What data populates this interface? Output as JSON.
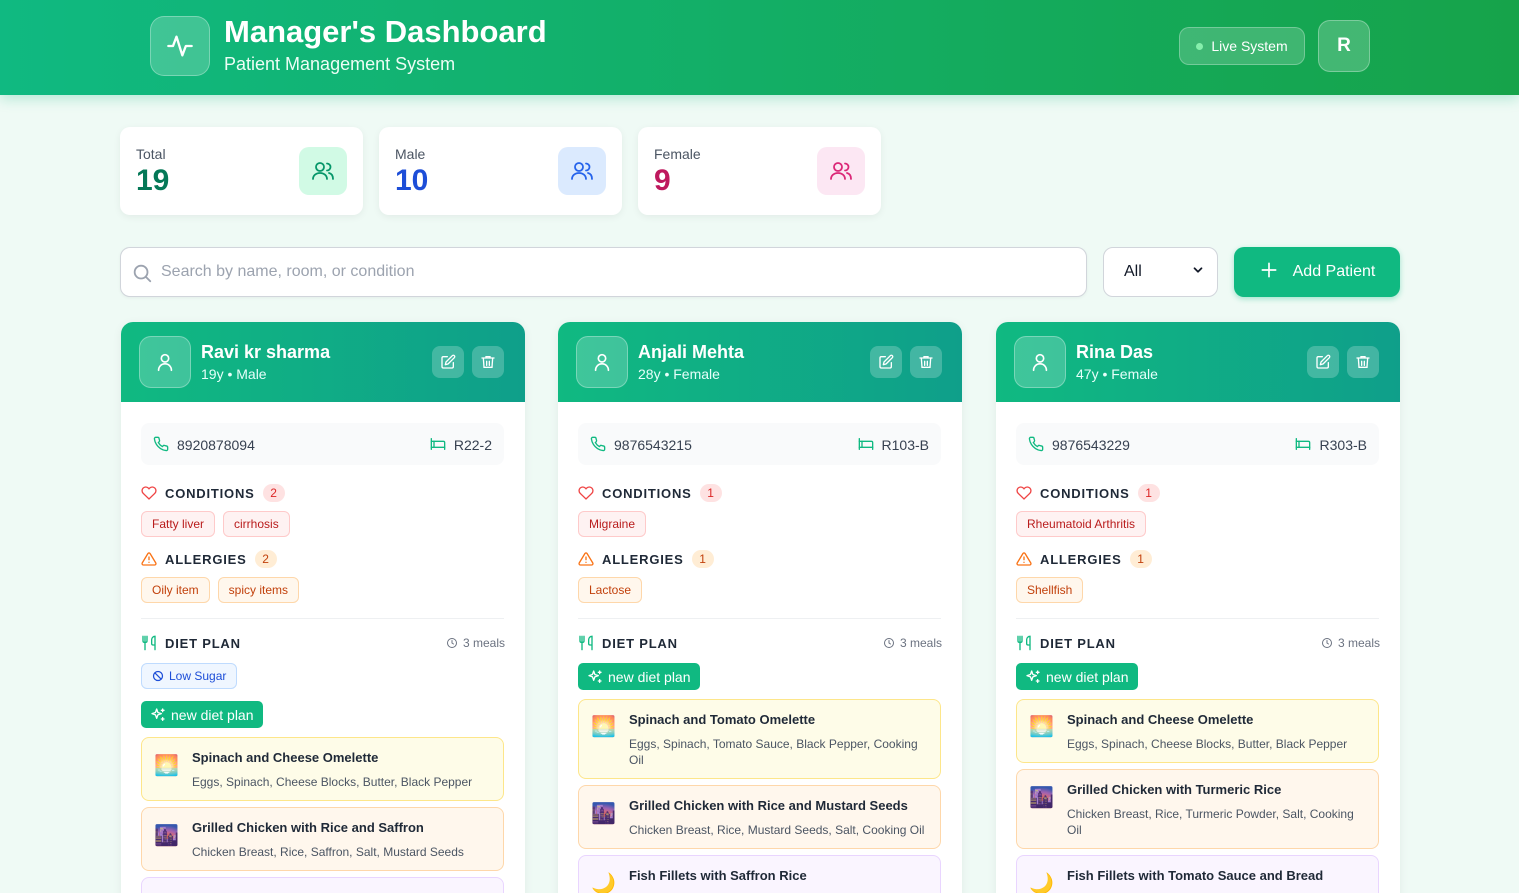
{
  "header": {
    "title": "Manager's Dashboard",
    "subtitle": "Patient Management System",
    "live_label": "Live System",
    "avatar_initial": "R"
  },
  "stats": [
    {
      "label": "Total",
      "value": "19",
      "color": "#047857",
      "icon_bg": "#d1fae5",
      "icon": "users-icon"
    },
    {
      "label": "Male",
      "value": "10",
      "color": "#1d4ed8",
      "icon_bg": "#dbeafe",
      "icon": "users-icon"
    },
    {
      "label": "Female",
      "value": "9",
      "color": "#be185d",
      "icon_bg": "#fce7f3",
      "icon": "users-icon"
    }
  ],
  "search": {
    "placeholder": "Search by name, room, or condition",
    "value": ""
  },
  "filter": {
    "selected": "All"
  },
  "add_button": {
    "label": "Add Patient"
  },
  "labels": {
    "conditions": "CONDITIONS",
    "allergies": "ALLERGIES",
    "diet_plan": "DIET PLAN",
    "new_diet_plan": "new diet plan"
  },
  "patients": [
    {
      "name": "Ravi kr sharma",
      "meta": "19y • Male",
      "phone": "8920878094",
      "room": "R22-2",
      "conditions_count": "2",
      "conditions": [
        "Fatty liver",
        "cirrhosis"
      ],
      "allergies_count": "2",
      "allergies": [
        "Oily item",
        "spicy items"
      ],
      "meals_count": "3 meals",
      "diet_tag": "Low Sugar",
      "meals": [
        {
          "type": "breakfast",
          "name": "Spinach and Cheese Omelette",
          "ingredients": "Eggs, Spinach, Cheese Blocks, Butter, Black Pepper"
        },
        {
          "type": "lunch",
          "name": "Grilled Chicken with Rice and Saffron",
          "ingredients": "Chicken Breast, Rice, Saffron, Salt, Mustard Seeds"
        }
      ]
    },
    {
      "name": "Anjali Mehta",
      "meta": "28y • Female",
      "phone": "9876543215",
      "room": "R103-B",
      "conditions_count": "1",
      "conditions": [
        "Migraine"
      ],
      "allergies_count": "1",
      "allergies": [
        "Lactose"
      ],
      "meals_count": "3 meals",
      "meals": [
        {
          "type": "breakfast",
          "name": "Spinach and Tomato Omelette",
          "ingredients": "Eggs, Spinach, Tomato Sauce, Black Pepper, Cooking Oil"
        },
        {
          "type": "lunch",
          "name": "Grilled Chicken with Rice and Mustard Seeds",
          "ingredients": "Chicken Breast, Rice, Mustard Seeds, Salt, Cooking Oil"
        },
        {
          "type": "dinner",
          "name": "Fish Fillets with Saffron Rice",
          "ingredients": ""
        }
      ]
    },
    {
      "name": "Rina Das",
      "meta": "47y • Female",
      "phone": "9876543229",
      "room": "R303-B",
      "conditions_count": "1",
      "conditions": [
        "Rheumatoid Arthritis"
      ],
      "allergies_count": "1",
      "allergies": [
        "Shellfish"
      ],
      "meals_count": "3 meals",
      "meals": [
        {
          "type": "breakfast",
          "name": "Spinach and Cheese Omelette",
          "ingredients": "Eggs, Spinach, Cheese Blocks, Butter, Black Pepper"
        },
        {
          "type": "lunch",
          "name": "Grilled Chicken with Turmeric Rice",
          "ingredients": "Chicken Breast, Rice, Turmeric Powder, Salt, Cooking Oil"
        },
        {
          "type": "dinner",
          "name": "Fish Fillets with Tomato Sauce and Bread",
          "ingredients": ""
        }
      ]
    }
  ]
}
